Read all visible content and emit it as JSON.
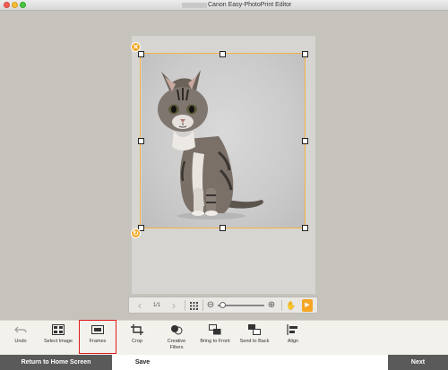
{
  "window": {
    "title": "Canon Easy-PhotoPrint Editor"
  },
  "canvas": {
    "photo_subject": "tabby-kitten-photo",
    "accent_color": "#f4a623",
    "selection_color": "#f4b342",
    "delete_glyph": "✕",
    "rotate_glyph": "↻"
  },
  "page_nav": {
    "prev_label": "‹",
    "page_indicator": "1/1",
    "next_label": "›",
    "zoom_out_label": "⊖",
    "zoom_in_label": "⊕",
    "hand_label": "✋",
    "pointer_label": "▶",
    "zoom_level": 0.05
  },
  "functions": [
    {
      "id": "undo",
      "label": "Undo"
    },
    {
      "id": "select-image",
      "label": "Select Image"
    },
    {
      "id": "frames",
      "label": "Frames"
    },
    {
      "id": "crop",
      "label": "Crop"
    },
    {
      "id": "creative-filters",
      "label": "Creative\nFilters"
    },
    {
      "id": "bring-to-front",
      "label": "Bring to Front"
    },
    {
      "id": "send-to-back",
      "label": "Send to Back"
    },
    {
      "id": "align",
      "label": "Align"
    }
  ],
  "footer": {
    "home_label": "Return to Home Screen",
    "save_label": "Save",
    "next_label": "Next"
  }
}
